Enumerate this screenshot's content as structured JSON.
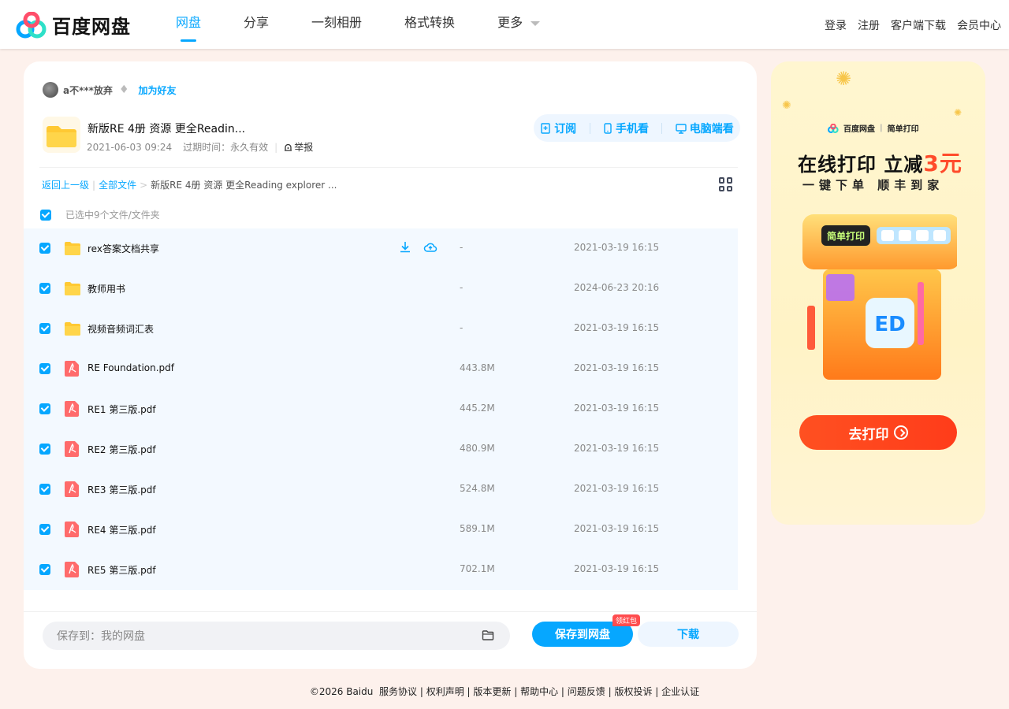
{
  "header": {
    "logo_text": "百度网盘",
    "nav": [
      {
        "label": "网盘",
        "active": true
      },
      {
        "label": "分享",
        "active": false
      },
      {
        "label": "一刻相册",
        "active": false
      },
      {
        "label": "格式转换",
        "active": false
      },
      {
        "label": "更多",
        "active": false
      }
    ],
    "right_links": [
      "登录",
      "注册",
      "客户端下载",
      "会员中心"
    ]
  },
  "share": {
    "username": "a不***放弃",
    "add_friend": "加为好友",
    "title": "新版RE 4册 资源 更全Readin...",
    "date": "2021-06-03 09:24",
    "expiry": "过期时间：永久有效",
    "report": "举报",
    "actions": [
      "订阅",
      "手机看",
      "电脑端看"
    ]
  },
  "breadcrumb": {
    "back": "返回上一级",
    "all_files": "全部文件",
    "current": "新版RE 4册 资源 更全Reading explorer ..."
  },
  "selection_text": "已选中9个文件/文件夹",
  "files": [
    {
      "name": "rex答案文档共享",
      "type": "folder",
      "size": "-",
      "date": "2021-03-19 16:15",
      "hovered": true
    },
    {
      "name": "教师用书",
      "type": "folder",
      "size": "-",
      "date": "2024-06-23 20:16"
    },
    {
      "name": "视频音频词汇表",
      "type": "folder",
      "size": "-",
      "date": "2021-03-19 16:15"
    },
    {
      "name": "RE Foundation.pdf",
      "type": "pdf",
      "size": "443.8M",
      "date": "2021-03-19 16:15"
    },
    {
      "name": "RE1 第三版.pdf",
      "type": "pdf",
      "size": "445.2M",
      "date": "2021-03-19 16:15"
    },
    {
      "name": "RE2 第三版.pdf",
      "type": "pdf",
      "size": "480.9M",
      "date": "2021-03-19 16:15"
    },
    {
      "name": "RE3 第三版.pdf",
      "type": "pdf",
      "size": "524.8M",
      "date": "2021-03-19 16:15"
    },
    {
      "name": "RE4 第三版.pdf",
      "type": "pdf",
      "size": "589.1M",
      "date": "2021-03-19 16:15"
    },
    {
      "name": "RE5 第三版.pdf",
      "type": "pdf",
      "size": "702.1M",
      "date": "2021-03-19 16:15"
    }
  ],
  "bottom": {
    "save_path": "保存到：我的网盘",
    "save_button": "保存到网盘",
    "badge": "领红包",
    "download_button": "下载"
  },
  "ad": {
    "brand_left": "百度网盘",
    "brand_right": "简单打印",
    "headline": "在线打印 立减",
    "headline_highlight": "3元",
    "subline": "一键下单  顺丰到家",
    "machine_label": "简单打印",
    "button": "去打印"
  },
  "footer": {
    "copyright": "©2026 Baidu",
    "links": [
      "服务协议",
      "权利声明",
      "版本更新",
      "帮助中心",
      "问题反馈",
      "版权投诉",
      "企业认证"
    ]
  },
  "colors": {
    "accent": "#06a7ff",
    "page_bg": "#fdf1ec",
    "ad_red": "#ff4b2b"
  }
}
